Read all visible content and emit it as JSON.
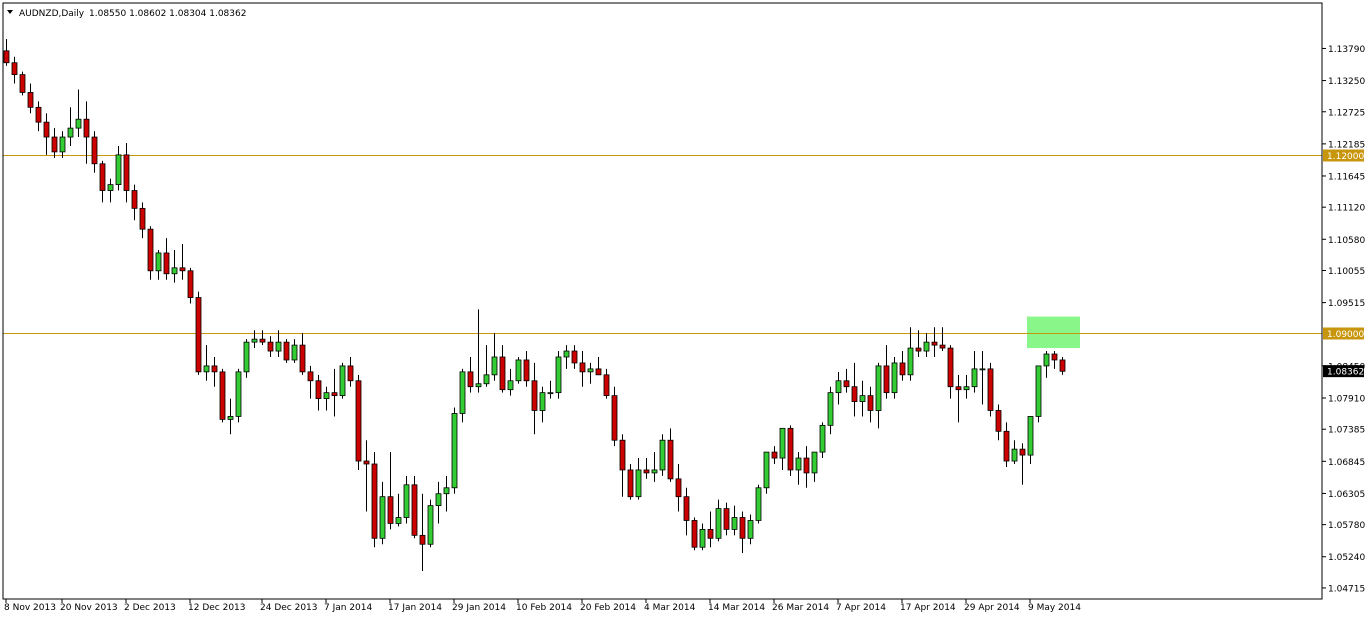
{
  "header": {
    "symbol_timeframe": "AUDNZD,Daily",
    "ohlc": "1.08550 1.08602 1.08304 1.08362"
  },
  "colors": {
    "background": "#ffffff",
    "grid_border": "#000000",
    "bull_body": "#33cc33",
    "bear_body": "#cc0000",
    "wick": "#000000",
    "level_line": "#c8960c",
    "level_label_bg": "#c8960c",
    "price_label_bg": "#000000",
    "zone_fill": "#7cf57c"
  },
  "chart_data": {
    "type": "candlestick",
    "title": "AUDNZD,Daily",
    "ylim": [
      1.0463,
      1.1405
    ],
    "y_ticks": [
      "1.13790",
      "1.13250",
      "1.12725",
      "1.12185",
      "1.11645",
      "1.11120",
      "1.10580",
      "1.10055",
      "1.09515",
      "1.08450",
      "1.07910",
      "1.07385",
      "1.06845",
      "1.06305",
      "1.05780",
      "1.05240",
      "1.04715"
    ],
    "x_labels": [
      {
        "label": "8 Nov 2013",
        "index": 0
      },
      {
        "label": "20 Nov 2013",
        "index": 7
      },
      {
        "label": "2 Dec 2013",
        "index": 15
      },
      {
        "label": "12 Dec 2013",
        "index": 23
      },
      {
        "label": "24 Dec 2013",
        "index": 32
      },
      {
        "label": "7 Jan 2014",
        "index": 40
      },
      {
        "label": "17 Jan 2014",
        "index": 48
      },
      {
        "label": "29 Jan 2014",
        "index": 56
      },
      {
        "label": "10 Feb 2014",
        "index": 64
      },
      {
        "label": "20 Feb 2014",
        "index": 72
      },
      {
        "label": "4 Mar 2014",
        "index": 80
      },
      {
        "label": "14 Mar 2014",
        "index": 88
      },
      {
        "label": "26 Mar 2014",
        "index": 96
      },
      {
        "label": "7 Apr 2014",
        "index": 104
      },
      {
        "label": "17 Apr 2014",
        "index": 112
      },
      {
        "label": "29 Apr 2014",
        "index": 120
      },
      {
        "label": "9 May 2014",
        "index": 128
      }
    ],
    "candles": [
      [
        1.1375,
        1.1395,
        1.135,
        1.1355
      ],
      [
        1.1355,
        1.1365,
        1.132,
        1.1335
      ],
      [
        1.1335,
        1.134,
        1.13,
        1.1305
      ],
      [
        1.1305,
        1.132,
        1.127,
        1.128
      ],
      [
        1.128,
        1.129,
        1.124,
        1.1255
      ],
      [
        1.1255,
        1.127,
        1.12,
        1.123
      ],
      [
        1.123,
        1.1245,
        1.1195,
        1.1205
      ],
      [
        1.1205,
        1.124,
        1.1195,
        1.123
      ],
      [
        1.123,
        1.128,
        1.1215,
        1.1245
      ],
      [
        1.1245,
        1.131,
        1.123,
        1.126
      ],
      [
        1.126,
        1.129,
        1.1185,
        1.123
      ],
      [
        1.123,
        1.124,
        1.117,
        1.1185
      ],
      [
        1.1185,
        1.119,
        1.112,
        1.114
      ],
      [
        1.114,
        1.116,
        1.112,
        1.115
      ],
      [
        1.115,
        1.1215,
        1.114,
        1.12
      ],
      [
        1.12,
        1.122,
        1.112,
        1.114
      ],
      [
        1.114,
        1.115,
        1.109,
        1.111
      ],
      [
        1.111,
        1.112,
        1.106,
        1.1075
      ],
      [
        1.1075,
        1.108,
        1.099,
        1.1005
      ],
      [
        1.1005,
        1.104,
        1.099,
        1.1035
      ],
      [
        1.1035,
        1.106,
        1.099,
        1.1
      ],
      [
        1.1,
        1.104,
        1.0985,
        1.101
      ],
      [
        1.101,
        1.105,
        1.099,
        1.1005
      ],
      [
        1.1005,
        1.101,
        1.095,
        1.096
      ],
      [
        1.096,
        1.097,
        1.083,
        1.0835
      ],
      [
        1.0835,
        1.088,
        1.082,
        1.0845
      ],
      [
        1.0845,
        1.086,
        1.081,
        1.0835
      ],
      [
        1.0835,
        1.084,
        1.075,
        1.0755
      ],
      [
        1.0755,
        1.079,
        1.073,
        1.076
      ],
      [
        1.076,
        1.084,
        1.075,
        1.0835
      ],
      [
        1.0835,
        1.089,
        1.0825,
        1.0885
      ],
      [
        1.0885,
        1.0905,
        1.0875,
        1.089
      ],
      [
        1.089,
        1.0905,
        1.088,
        1.0885
      ],
      [
        1.0885,
        1.0895,
        1.086,
        1.087
      ],
      [
        1.087,
        1.0905,
        1.086,
        1.0885
      ],
      [
        1.0885,
        1.089,
        1.085,
        1.0855
      ],
      [
        1.0855,
        1.089,
        1.085,
        1.088
      ],
      [
        1.088,
        1.09,
        1.083,
        1.0835
      ],
      [
        1.0835,
        1.0845,
        1.079,
        1.082
      ],
      [
        1.082,
        1.083,
        1.077,
        1.079
      ],
      [
        1.079,
        1.081,
        1.077,
        1.08
      ],
      [
        1.08,
        1.084,
        1.076,
        1.0795
      ],
      [
        1.0795,
        1.085,
        1.079,
        1.0845
      ],
      [
        1.0845,
        1.086,
        1.081,
        1.082
      ],
      [
        1.082,
        1.083,
        1.067,
        1.0685
      ],
      [
        1.0685,
        1.072,
        1.06,
        1.068
      ],
      [
        1.068,
        1.07,
        1.054,
        1.0555
      ],
      [
        1.0555,
        1.065,
        1.0545,
        1.0625
      ],
      [
        1.0625,
        1.07,
        1.057,
        1.058
      ],
      [
        1.058,
        1.063,
        1.0575,
        1.059
      ],
      [
        1.059,
        1.066,
        1.058,
        1.0645
      ],
      [
        1.0645,
        1.066,
        1.0555,
        1.056
      ],
      [
        1.056,
        1.063,
        1.05,
        1.0545
      ],
      [
        1.0545,
        1.062,
        1.054,
        1.061
      ],
      [
        1.061,
        1.065,
        1.058,
        1.063
      ],
      [
        1.063,
        1.066,
        1.06,
        1.064
      ],
      [
        1.064,
        1.0775,
        1.063,
        1.0765
      ],
      [
        1.0765,
        1.084,
        1.075,
        1.0835
      ],
      [
        1.0835,
        1.086,
        1.08,
        1.081
      ],
      [
        1.081,
        1.094,
        1.08,
        1.0815
      ],
      [
        1.0815,
        1.088,
        1.081,
        1.083
      ],
      [
        1.083,
        1.09,
        1.082,
        1.086
      ],
      [
        1.086,
        1.088,
        1.08,
        1.0805
      ],
      [
        1.0805,
        1.084,
        1.0795,
        1.082
      ],
      [
        1.082,
        1.086,
        1.0815,
        1.0855
      ],
      [
        1.0855,
        1.087,
        1.081,
        1.082
      ],
      [
        1.082,
        1.085,
        1.073,
        1.077
      ],
      [
        1.077,
        1.081,
        1.075,
        1.08
      ],
      [
        1.08,
        1.082,
        1.079,
        1.08
      ],
      [
        1.08,
        1.087,
        1.079,
        1.086
      ],
      [
        1.086,
        1.088,
        1.084,
        1.087
      ],
      [
        1.087,
        1.088,
        1.084,
        1.085
      ],
      [
        1.085,
        1.087,
        1.081,
        1.0835
      ],
      [
        1.0835,
        1.085,
        1.0815,
        1.084
      ],
      [
        1.084,
        1.086,
        1.083,
        1.083
      ],
      [
        1.083,
        1.084,
        1.079,
        1.0795
      ],
      [
        1.0795,
        1.081,
        1.071,
        1.072
      ],
      [
        1.072,
        1.073,
        1.0625,
        1.067
      ],
      [
        1.067,
        1.068,
        1.062,
        1.0625
      ],
      [
        1.0625,
        1.069,
        1.062,
        1.067
      ],
      [
        1.067,
        1.069,
        1.0655,
        1.0665
      ],
      [
        1.0665,
        1.07,
        1.065,
        1.067
      ],
      [
        1.067,
        1.073,
        1.066,
        1.072
      ],
      [
        1.072,
        1.074,
        1.065,
        1.0655
      ],
      [
        1.0655,
        1.068,
        1.06,
        1.0625
      ],
      [
        1.0625,
        1.064,
        1.056,
        1.0585
      ],
      [
        1.0585,
        1.059,
        1.0535,
        1.054
      ],
      [
        1.054,
        1.058,
        1.0535,
        1.057
      ],
      [
        1.057,
        1.06,
        1.054,
        1.0555
      ],
      [
        1.0555,
        1.062,
        1.055,
        1.0605
      ],
      [
        1.0605,
        1.0615,
        1.056,
        1.057
      ],
      [
        1.057,
        1.061,
        1.056,
        1.059
      ],
      [
        1.059,
        1.06,
        1.053,
        1.0555
      ],
      [
        1.0555,
        1.0595,
        1.0545,
        1.0585
      ],
      [
        1.0585,
        1.0645,
        1.058,
        1.064
      ],
      [
        1.064,
        1.07,
        1.063,
        1.07
      ],
      [
        1.07,
        1.071,
        1.068,
        1.069
      ],
      [
        1.069,
        1.074,
        1.067,
        1.074
      ],
      [
        1.074,
        1.0745,
        1.066,
        1.067
      ],
      [
        1.067,
        1.07,
        1.0645,
        1.069
      ],
      [
        1.069,
        1.071,
        1.064,
        1.0665
      ],
      [
        1.0665,
        1.07,
        1.065,
        1.07
      ],
      [
        1.07,
        1.075,
        1.069,
        1.0745
      ],
      [
        1.0745,
        1.081,
        1.073,
        1.08
      ],
      [
        1.08,
        1.0835,
        1.078,
        1.082
      ],
      [
        1.082,
        1.084,
        1.08,
        1.081
      ],
      [
        1.081,
        1.085,
        1.076,
        1.0785
      ],
      [
        1.0785,
        1.082,
        1.076,
        1.0795
      ],
      [
        1.0795,
        1.081,
        1.075,
        1.077
      ],
      [
        1.077,
        1.085,
        1.074,
        1.0845
      ],
      [
        1.0845,
        1.088,
        1.079,
        1.08
      ],
      [
        1.08,
        1.086,
        1.079,
        1.085
      ],
      [
        1.085,
        1.087,
        1.082,
        1.083
      ],
      [
        1.083,
        1.091,
        1.082,
        1.0875
      ],
      [
        1.0875,
        1.0905,
        1.086,
        1.087
      ],
      [
        1.087,
        1.09,
        1.086,
        1.0885
      ],
      [
        1.0885,
        1.091,
        1.086,
        1.088
      ],
      [
        1.088,
        1.091,
        1.087,
        1.0875
      ],
      [
        1.0875,
        1.088,
        1.079,
        1.081
      ],
      [
        1.081,
        1.083,
        1.075,
        1.0805
      ],
      [
        1.0805,
        1.083,
        1.079,
        1.081
      ],
      [
        1.081,
        1.087,
        1.08,
        1.084
      ],
      [
        1.084,
        1.087,
        1.078,
        1.084
      ],
      [
        1.084,
        1.085,
        1.076,
        1.077
      ],
      [
        1.077,
        1.078,
        1.072,
        1.0735
      ],
      [
        1.0735,
        1.075,
        1.0675,
        1.0685
      ],
      [
        1.0685,
        1.072,
        1.068,
        1.0705
      ],
      [
        1.0705,
        1.0715,
        1.0645,
        1.0695
      ],
      [
        1.0695,
        1.076,
        1.068,
        1.076
      ],
      [
        1.076,
        1.0845,
        1.075,
        1.0845
      ],
      [
        1.0845,
        1.087,
        1.0825,
        1.0865
      ],
      [
        1.0865,
        1.087,
        1.084,
        1.0855
      ],
      [
        1.0855,
        1.086,
        1.083,
        1.0836
      ]
    ],
    "horizontal_lines": [
      {
        "value": 1.12,
        "label": "1.12000"
      },
      {
        "value": 1.09,
        "label": "1.09000"
      }
    ],
    "current_price": {
      "value": 1.08362,
      "label": "1.08362"
    },
    "zone": {
      "index_from": 128,
      "index_to": 134,
      "y_from": 1.0875,
      "y_to": 1.0928
    },
    "grid": false
  }
}
